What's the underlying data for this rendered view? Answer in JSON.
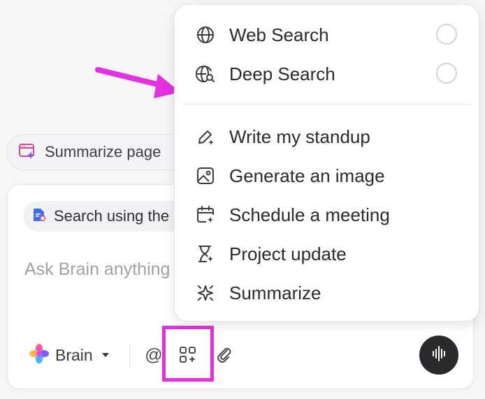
{
  "suggestion_chip": {
    "label": "Summarize page"
  },
  "composer": {
    "search_chip_label": "Search using the",
    "input_placeholder": "Ask Brain anything",
    "brain_label": "Brain",
    "at_symbol": "@"
  },
  "menu": {
    "search_options": [
      {
        "label": "Web Search",
        "icon": "globe-icon",
        "selected": false
      },
      {
        "label": "Deep Search",
        "icon": "globe-search-icon",
        "selected": false
      }
    ],
    "actions": [
      {
        "label": "Write my standup",
        "icon": "pen-sparkle-icon"
      },
      {
        "label": "Generate an image",
        "icon": "image-icon"
      },
      {
        "label": "Schedule a meeting",
        "icon": "calendar-icon"
      },
      {
        "label": "Project update",
        "icon": "hourglass-icon"
      },
      {
        "label": "Summarize",
        "icon": "sparkle-icon"
      }
    ]
  },
  "colors": {
    "highlight": "#e331e2",
    "arrow": "#e331e2",
    "voice_button": "#2a2a2c"
  }
}
